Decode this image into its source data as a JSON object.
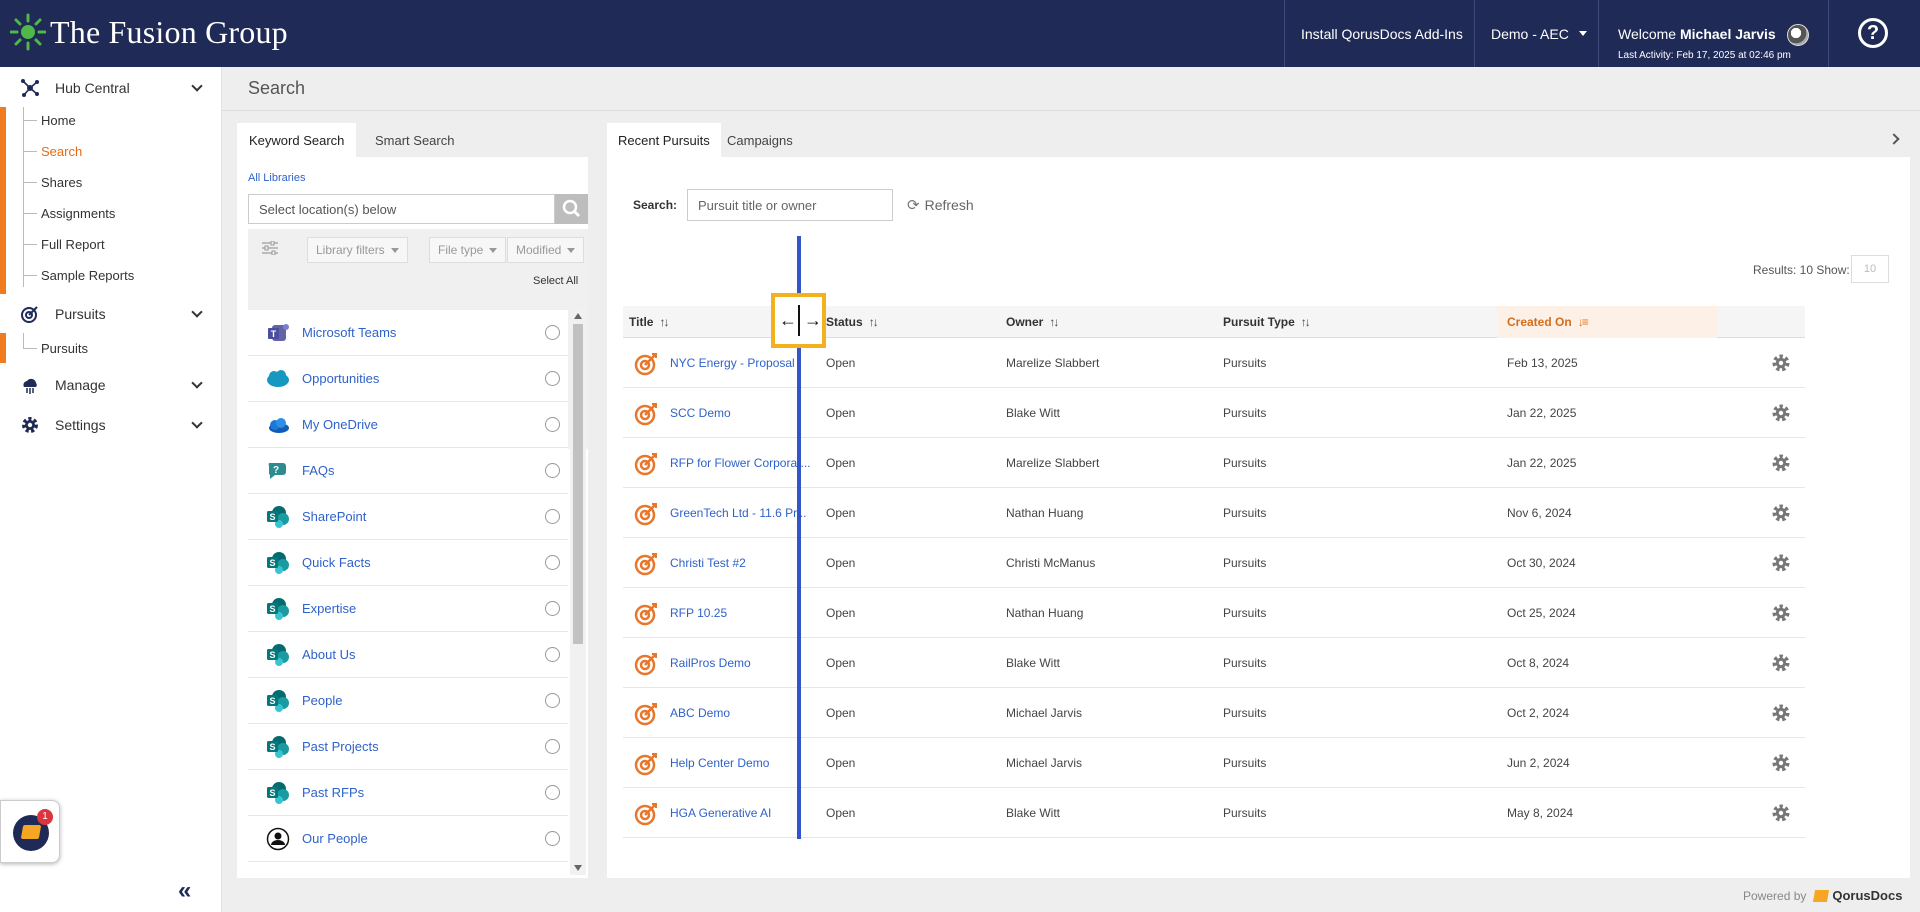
{
  "header": {
    "brand": "The Fusion Group",
    "install_addins": "Install QorusDocs Add-Ins",
    "environment": "Demo - AEC",
    "welcome_prefix": "Welcome",
    "user_name": "Michael Jarvis",
    "last_activity": "Last Activity: Feb 17, 2025 at 02:46 pm",
    "help_glyph": "?"
  },
  "sidebar": {
    "groups": [
      {
        "label": "Hub Central",
        "icon": "hub-icon"
      },
      {
        "label": "Pursuits",
        "icon": "target-icon"
      },
      {
        "label": "Manage",
        "icon": "cloud-icon"
      },
      {
        "label": "Settings",
        "icon": "gear-icon"
      }
    ],
    "hub_items": [
      "Home",
      "Search",
      "Shares",
      "Assignments",
      "Full Report",
      "Sample Reports"
    ],
    "pursuit_items": [
      "Pursuits"
    ],
    "active_item": "Search",
    "widget_badge": "1",
    "collapse_glyph": "«"
  },
  "page": {
    "title": "Search"
  },
  "left_panel": {
    "tabs": [
      "Keyword Search",
      "Smart Search"
    ],
    "all_libraries": "All Libraries",
    "location_placeholder": "Select location(s) below",
    "filters": [
      "Library filters",
      "File type",
      "Modified"
    ],
    "select_all": "Select All",
    "libraries": [
      {
        "label": "Microsoft Teams",
        "icon": "teams-icon"
      },
      {
        "label": "Opportunities",
        "icon": "salesforce-icon"
      },
      {
        "label": "My OneDrive",
        "icon": "onedrive-icon"
      },
      {
        "label": "FAQs",
        "icon": "faq-icon"
      },
      {
        "label": "SharePoint",
        "icon": "sharepoint-icon"
      },
      {
        "label": "Quick Facts",
        "icon": "sharepoint-icon"
      },
      {
        "label": "Expertise",
        "icon": "sharepoint-icon"
      },
      {
        "label": "About Us",
        "icon": "sharepoint-icon"
      },
      {
        "label": "People",
        "icon": "sharepoint-icon"
      },
      {
        "label": "Past Projects",
        "icon": "sharepoint-icon"
      },
      {
        "label": "Past RFPs",
        "icon": "sharepoint-icon"
      },
      {
        "label": "Our People",
        "icon": "person-icon"
      }
    ]
  },
  "right_panel": {
    "tabs": [
      "Recent Pursuits",
      "Campaigns"
    ],
    "search_label": "Search:",
    "search_placeholder": "Pursuit title or owner",
    "refresh_label": "Refresh",
    "results_text": "Results: 10  Show:",
    "show_value": "10",
    "columns": [
      "Title",
      "Status",
      "Owner",
      "Pursuit Type",
      "Created On"
    ],
    "sorted_column": "Created On",
    "rows": [
      {
        "title": "NYC Energy - Proposal",
        "status": "Open",
        "owner": "Marelize Slabbert",
        "type": "Pursuits",
        "created": "Feb 13, 2025"
      },
      {
        "title": "SCC Demo",
        "status": "Open",
        "owner": "Blake Witt",
        "type": "Pursuits",
        "created": "Jan 22, 2025"
      },
      {
        "title": "RFP for Flower Corporat...",
        "status": "Open",
        "owner": "Marelize Slabbert",
        "type": "Pursuits",
        "created": "Jan 22, 2025"
      },
      {
        "title": "GreenTech Ltd - 11.6 Pr...",
        "status": "Open",
        "owner": "Nathan Huang",
        "type": "Pursuits",
        "created": "Nov 6, 2024"
      },
      {
        "title": "Christi Test #2",
        "status": "Open",
        "owner": "Christi McManus",
        "type": "Pursuits",
        "created": "Oct 30, 2024"
      },
      {
        "title": "RFP 10.25",
        "status": "Open",
        "owner": "Nathan Huang",
        "type": "Pursuits",
        "created": "Oct 25, 2024"
      },
      {
        "title": "RailPros Demo",
        "status": "Open",
        "owner": "Blake Witt",
        "type": "Pursuits",
        "created": "Oct 8, 2024"
      },
      {
        "title": "ABC Demo",
        "status": "Open",
        "owner": "Michael Jarvis",
        "type": "Pursuits",
        "created": "Oct 2, 2024"
      },
      {
        "title": "Help Center Demo",
        "status": "Open",
        "owner": "Michael Jarvis",
        "type": "Pursuits",
        "created": "Jun 2, 2024"
      },
      {
        "title": "HGA Generative AI",
        "status": "Open",
        "owner": "Blake Witt",
        "type": "Pursuits",
        "created": "May 8, 2024"
      }
    ]
  },
  "footer": {
    "powered_by": "Powered by",
    "brand": "QorusDocs"
  },
  "colors": {
    "navy": "#1f2a57",
    "accent_orange": "#f07c1f",
    "link_blue": "#2f62c9",
    "resize_guide": "#3355cc",
    "highlight": "#f2b21f"
  }
}
